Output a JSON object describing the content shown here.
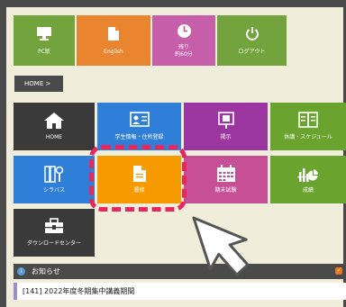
{
  "top_tiles": [
    {
      "label": "PC版",
      "icon": "monitor-icon",
      "color": "#72a33d"
    },
    {
      "label": "English",
      "icon": "document-icon",
      "color": "#e8852e"
    },
    {
      "label": "残り",
      "sublabel": "約60分",
      "icon": "clock-icon",
      "color": "#c75ea9"
    },
    {
      "label": "ログアウト",
      "icon": "power-icon",
      "color": "#72a33d"
    }
  ],
  "breadcrumb": "HOME >",
  "menu_tiles": [
    {
      "label": "HOME",
      "icon": "home-icon",
      "color": "#3a3a3a"
    },
    {
      "label": "学生情報・住所登録",
      "icon": "id-card-icon",
      "color": "#2f7fd8"
    },
    {
      "label": "掲示",
      "icon": "board-icon",
      "color": "#9b35a0"
    },
    {
      "label": "休講・スケジュール",
      "icon": "book-icon",
      "color": "#6aa42f"
    },
    {
      "label": "シラバス",
      "icon": "books-icon",
      "color": "#2f7fd8"
    },
    {
      "label": "履修",
      "icon": "document-icon",
      "color": "#f59b00"
    },
    {
      "label": "期末試験",
      "icon": "calendar-icon",
      "color": "#c64f96"
    },
    {
      "label": "成績",
      "icon": "chart-icon",
      "color": "#6aa42f"
    },
    {
      "label": "ダウンロードセンター",
      "icon": "toolbox-icon",
      "color": "#3a3a3a"
    }
  ],
  "news": {
    "title": "お知らせ",
    "items": [
      "[141]  2022年度冬期集中講義期間"
    ]
  }
}
